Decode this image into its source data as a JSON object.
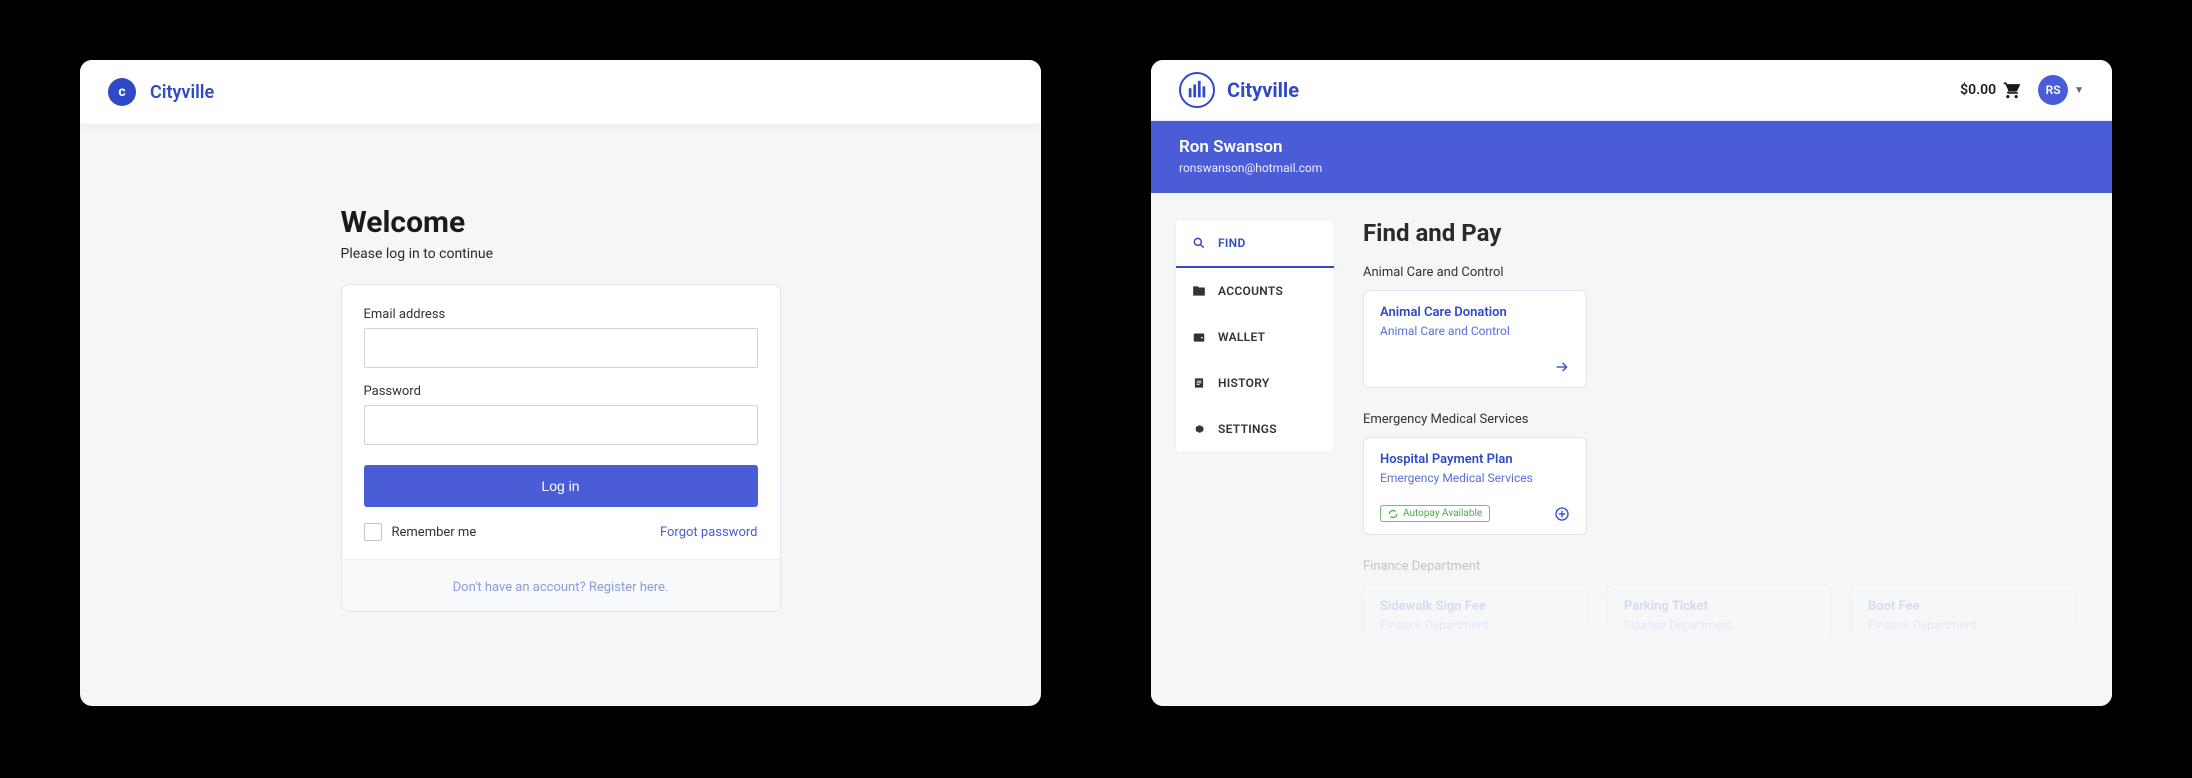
{
  "login": {
    "brand": "Cityville",
    "logo_letter": "c",
    "title": "Welcome",
    "subtitle": "Please log in to continue",
    "email_label": "Email address",
    "password_label": "Password",
    "login_button": "Log in",
    "remember_label": "Remember me",
    "forgot_label": "Forgot password",
    "register_prompt": "Don't have an account? Register here."
  },
  "dashboard": {
    "brand": "Cityville",
    "cart_total": "$0.00",
    "avatar_initials": "RS",
    "user_name": "Ron Swanson",
    "user_email": "ronswanson@hotmail.com",
    "sidebar": [
      {
        "label": "FIND",
        "icon": "search"
      },
      {
        "label": "ACCOUNTS",
        "icon": "folder"
      },
      {
        "label": "WALLET",
        "icon": "wallet"
      },
      {
        "label": "HISTORY",
        "icon": "history"
      },
      {
        "label": "SETTINGS",
        "icon": "gear"
      }
    ],
    "content_title": "Find and Pay",
    "sections": [
      {
        "label": "Animal Care and Control",
        "cards": [
          {
            "title": "Animal Care Donation",
            "subtitle": "Animal Care and Control",
            "action": "arrow"
          }
        ]
      },
      {
        "label": "Emergency Medical Services",
        "cards": [
          {
            "title": "Hospital Payment Plan",
            "subtitle": "Emergency Medical Services",
            "autopay": "Autopay Available",
            "action": "plus"
          }
        ]
      },
      {
        "label": "Finance Department",
        "faded": true,
        "cards": [
          {
            "title": "Sidewalk Sign Fee",
            "subtitle": "Finance Department"
          },
          {
            "title": "Parking Ticket",
            "subtitle": "Finance Department"
          },
          {
            "title": "Boot Fee",
            "subtitle": "Finance Department"
          }
        ]
      }
    ]
  }
}
